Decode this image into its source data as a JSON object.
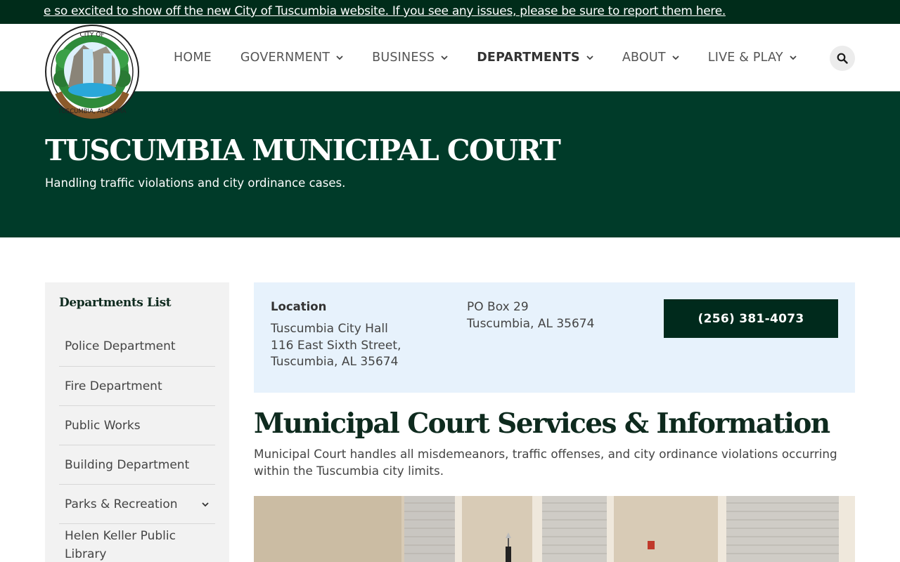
{
  "announcement": {
    "text": "e so excited to show off the new City of Tuscumbia website. If you see any issues, please be sure to report them here."
  },
  "logo": {
    "top_text": "CITY OF",
    "bottom_text": "TUSCUMBIA, ALABAMA"
  },
  "nav": {
    "items": [
      {
        "label": "HOME",
        "has_dropdown": false
      },
      {
        "label": "GOVERNMENT",
        "has_dropdown": true
      },
      {
        "label": "BUSINESS",
        "has_dropdown": true
      },
      {
        "label": "DEPARTMENTS",
        "has_dropdown": true,
        "active": true
      },
      {
        "label": "ABOUT",
        "has_dropdown": true
      },
      {
        "label": "LIVE & PLAY",
        "has_dropdown": true
      }
    ],
    "search_icon": "search-icon"
  },
  "hero": {
    "title": "TUSCUMBIA MUNICIPAL COURT",
    "subtitle": "Handling traffic violations and city ordinance cases."
  },
  "sidebar": {
    "title": "Departments List",
    "items": [
      {
        "label": "Police Department"
      },
      {
        "label": "Fire Department"
      },
      {
        "label": "Public Works"
      },
      {
        "label": "Building Department"
      },
      {
        "label": "Parks & Recreation",
        "has_children": true
      },
      {
        "label": "Helen Keller Public Library"
      }
    ]
  },
  "info": {
    "location_label": "Location",
    "address_line1": "Tuscumbia City Hall",
    "address_line2": "116 East Sixth Street,",
    "address_line3": "Tuscumbia, AL 35674",
    "po_line1": "PO Box 29",
    "po_line2": "Tuscumbia, AL 35674",
    "phone": "(256) 381-4073"
  },
  "main": {
    "title": "Municipal Court Services & Information",
    "description": "Municipal Court handles all misdemeanors, traffic offenses, and city ordinance violations occurring within the Tuscumbia city limits."
  },
  "colors": {
    "announcement_bg": "#002c1a",
    "hero_bg": "#003b29",
    "info_bg": "#e7f2fc",
    "button_bg": "#002a1c",
    "sidebar_bg": "#f2f2f2"
  }
}
